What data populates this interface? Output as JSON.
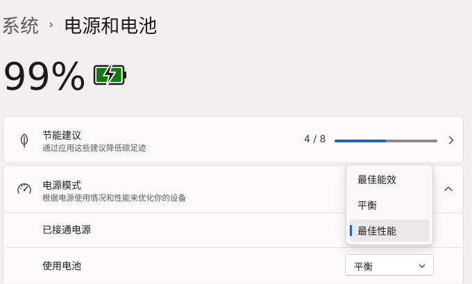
{
  "breadcrumb": {
    "parent": "系统",
    "separator": "›",
    "current": "电源和电池"
  },
  "battery": {
    "percent_text": "99%",
    "level": 0.99,
    "charging": true,
    "icon": "battery-charging-icon",
    "fill_color": "#107c10"
  },
  "energy_recommendations": {
    "icon": "leaf-icon",
    "title": "节能建议",
    "subtitle": "通过应用这些建议降低碳足迹",
    "progress_text": "4 / 8",
    "progress_fraction": 0.5,
    "chevron_icon": "chevron-right-icon"
  },
  "power_mode": {
    "icon": "speedometer-icon",
    "title": "电源模式",
    "subtitle": "根据电源使用情况和性能来优化你的设备",
    "chevron_icon": "chevron-up-icon",
    "plugged_in": {
      "label": "已接通电源"
    },
    "on_battery": {
      "label": "使用电池",
      "selected_value": "平衡",
      "chevron_icon": "chevron-down-icon"
    }
  },
  "dropdown": {
    "options": [
      "最佳能效",
      "平衡",
      "最佳性能"
    ],
    "selected_index": 2
  },
  "colors": {
    "accent": "#1a66b8",
    "battery_green": "#107c10",
    "page_bg": "#f3eff0",
    "card_bg": "#fbf9f9"
  }
}
